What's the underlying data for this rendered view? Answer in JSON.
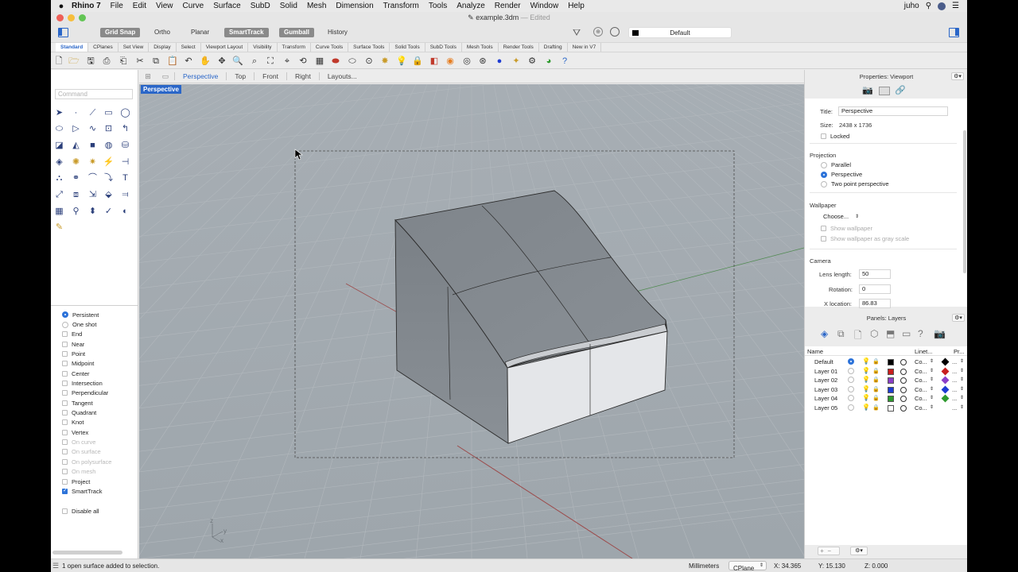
{
  "menubar": {
    "app_name": "Rhino 7",
    "items": [
      "File",
      "Edit",
      "View",
      "Curve",
      "Surface",
      "SubD",
      "Solid",
      "Mesh",
      "Dimension",
      "Transform",
      "Tools",
      "Analyze",
      "Render",
      "Window",
      "Help"
    ],
    "user": "juho"
  },
  "window": {
    "title": "example.3dm",
    "edited": "— Edited"
  },
  "toolbar": {
    "grid_snap": "Grid Snap",
    "ortho": "Ortho",
    "planar": "Planar",
    "smarttrack": "SmartTrack",
    "gumball": "Gumball",
    "history": "History",
    "current_layer": "Default"
  },
  "tabs": [
    "Standard",
    "CPlanes",
    "Set View",
    "Display",
    "Select",
    "Viewport Layout",
    "Visibility",
    "Transform",
    "Curve Tools",
    "Surface Tools",
    "Solid Tools",
    "SubD Tools",
    "Mesh Tools",
    "Render Tools",
    "Drafting",
    "New in V7"
  ],
  "command": {
    "placeholder": "Command"
  },
  "osnaps": [
    {
      "label": "Persistent",
      "type": "radio",
      "checked": true,
      "enabled": true
    },
    {
      "label": "One shot",
      "type": "radio",
      "checked": false,
      "enabled": true
    },
    {
      "label": "End",
      "type": "check",
      "checked": false,
      "enabled": true
    },
    {
      "label": "Near",
      "type": "check",
      "checked": false,
      "enabled": true
    },
    {
      "label": "Point",
      "type": "check",
      "checked": false,
      "enabled": true
    },
    {
      "label": "Midpoint",
      "type": "check",
      "checked": false,
      "enabled": true
    },
    {
      "label": "Center",
      "type": "check",
      "checked": false,
      "enabled": true
    },
    {
      "label": "Intersection",
      "type": "check",
      "checked": false,
      "enabled": true
    },
    {
      "label": "Perpendicular",
      "type": "check",
      "checked": false,
      "enabled": true
    },
    {
      "label": "Tangent",
      "type": "check",
      "checked": false,
      "enabled": true
    },
    {
      "label": "Quadrant",
      "type": "check",
      "checked": false,
      "enabled": true
    },
    {
      "label": "Knot",
      "type": "check",
      "checked": false,
      "enabled": true
    },
    {
      "label": "Vertex",
      "type": "check",
      "checked": false,
      "enabled": true
    },
    {
      "label": "On curve",
      "type": "check",
      "checked": false,
      "enabled": false
    },
    {
      "label": "On surface",
      "type": "check",
      "checked": false,
      "enabled": false
    },
    {
      "label": "On polysurface",
      "type": "check",
      "checked": false,
      "enabled": false
    },
    {
      "label": "On mesh",
      "type": "check",
      "checked": false,
      "enabled": false
    },
    {
      "label": "Project",
      "type": "check",
      "checked": false,
      "enabled": true
    },
    {
      "label": "SmartTrack",
      "type": "check",
      "checked": true,
      "enabled": true
    },
    {
      "label": "",
      "type": "spacer",
      "checked": false,
      "enabled": true
    },
    {
      "label": "Disable all",
      "type": "check",
      "checked": false,
      "enabled": true
    }
  ],
  "viewport_tabs": [
    "Perspective",
    "Top",
    "Front",
    "Right",
    "Layouts..."
  ],
  "viewport": {
    "label": "Perspective",
    "axis_z": "z",
    "axis_y": "y",
    "axis_x": "x"
  },
  "properties": {
    "header": "Properties: Viewport",
    "title_label": "Title:",
    "title_value": "Perspective",
    "size_label": "Size:",
    "size_value": "2438 x 1736",
    "locked_label": "Locked",
    "projection_section": "Projection",
    "projection_options": [
      "Parallel",
      "Perspective",
      "Two point perspective"
    ],
    "projection_selected": 1,
    "wallpaper_section": "Wallpaper",
    "wallpaper_choose": "Choose...",
    "show_wallpaper": "Show wallpaper",
    "show_wallpaper_gray": "Show wallpaper as gray scale",
    "camera_section": "Camera",
    "lens_label": "Lens length:",
    "lens_value": "50",
    "rotation_label": "Rotation:",
    "rotation_value": "0",
    "xloc_label": "X location:",
    "xloc_value": "86.83"
  },
  "layers": {
    "header": "Panels: Layers",
    "col_name": "Name",
    "col_linetype": "Linet...",
    "col_print": "Pr...",
    "rows": [
      {
        "name": "Default",
        "color": "#000000",
        "current": true,
        "linetype": "Co...",
        "print_color": "#000000",
        "dots": "..."
      },
      {
        "name": "Layer 01",
        "color": "#c81e1e",
        "current": false,
        "linetype": "Co...",
        "print_color": "#c81e1e",
        "dots": "..."
      },
      {
        "name": "Layer 02",
        "color": "#8b3fc8",
        "current": false,
        "linetype": "Co...",
        "print_color": "#8b3fc8",
        "dots": "..."
      },
      {
        "name": "Layer 03",
        "color": "#1e3cd2",
        "current": false,
        "linetype": "Co...",
        "print_color": "#1e3cd2",
        "dots": "..."
      },
      {
        "name": "Layer 04",
        "color": "#2e9a2e",
        "current": false,
        "linetype": "Co...",
        "print_color": "#2e9a2e",
        "dots": "..."
      },
      {
        "name": "Layer 05",
        "color": "#ffffff",
        "current": false,
        "linetype": "Co...",
        "print_color": "#ffffff",
        "dots": "..."
      }
    ]
  },
  "status": {
    "message": "1 open surface added to selection.",
    "units": "Millimeters",
    "cplane": "CPlane",
    "x": "X: 34.365",
    "y": "Y: 15.130",
    "z": "Z: 0.000"
  }
}
